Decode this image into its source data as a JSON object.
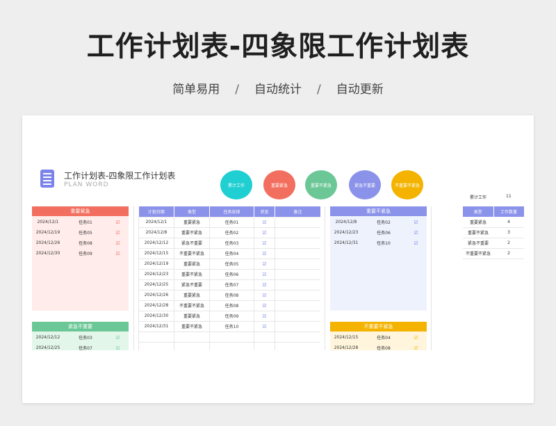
{
  "header": {
    "title": "工作计划表-四象限工作计划表",
    "tags": [
      "简单易用",
      "自动统计",
      "自动更新"
    ],
    "separator": "/"
  },
  "sheet": {
    "title": "工作计划表-四象限工作计划表",
    "subtitle": "PLAN WORD",
    "circles": [
      {
        "label": "累计工作",
        "color": "#1fcfd1"
      },
      {
        "label": "重要紧急",
        "color": "#f26f5f"
      },
      {
        "label": "重要不紧急",
        "color": "#6cc796"
      },
      {
        "label": "紧急不重要",
        "color": "#8a92ea"
      },
      {
        "label": "不重要不紧急",
        "color": "#f3b300"
      }
    ],
    "total_label": "累计工作",
    "total_value": "11"
  },
  "q_important_urgent": {
    "header": "重要紧急",
    "color": "#f26f5f",
    "bg": "#ffeceb",
    "rows": [
      [
        "2024/12/1",
        "任务01"
      ],
      [
        "2024/12/19",
        "任务05"
      ],
      [
        "2024/12/26",
        "任务08"
      ],
      [
        "2024/12/30",
        "任务09"
      ]
    ]
  },
  "q_urgent_not_important": {
    "header": "紧急不重要",
    "color": "#6cc796",
    "bg": "#e3f6ea",
    "rows": [
      [
        "2024/12/12",
        "任务03"
      ],
      [
        "2024/12/25",
        "任务07"
      ]
    ]
  },
  "main_table": {
    "columns": [
      "计划日期",
      "类型",
      "任务安排",
      "状态",
      "备注"
    ],
    "rows": [
      [
        "2024/12/1",
        "重要紧急",
        "任务01"
      ],
      [
        "2024/12/8",
        "重要不紧急",
        "任务02"
      ],
      [
        "2024/12/12",
        "紧急不重要",
        "任务03"
      ],
      [
        "2024/12/15",
        "不重要不紧急",
        "任务04"
      ],
      [
        "2024/12/19",
        "重要紧急",
        "任务05"
      ],
      [
        "2024/12/23",
        "重要不紧急",
        "任务06"
      ],
      [
        "2024/12/25",
        "紧急不重要",
        "任务07"
      ],
      [
        "2024/12/26",
        "重要紧急",
        "任务08"
      ],
      [
        "2024/12/28",
        "不重要不紧急",
        "任务08"
      ],
      [
        "2024/12/30",
        "重要紧急",
        "任务09"
      ],
      [
        "2024/12/31",
        "重要不紧急",
        "任务10"
      ]
    ]
  },
  "q_important_not_urgent": {
    "header": "重要不紧急",
    "color": "#8a92ea",
    "bg": "#eef2fd",
    "rows": [
      [
        "2024/12/8",
        "任务02"
      ],
      [
        "2024/12/23",
        "任务06"
      ],
      [
        "2024/12/31",
        "任务10"
      ]
    ]
  },
  "q_not_important_not_urgent": {
    "header": "不重要不紧急",
    "color": "#f3b300",
    "bg": "#fff5dc",
    "rows": [
      [
        "2024/12/15",
        "任务04"
      ],
      [
        "2024/12/28",
        "任务08"
      ]
    ]
  },
  "stats": {
    "columns": [
      "类型",
      "工作数量"
    ],
    "rows": [
      [
        "重要紧急",
        "4"
      ],
      [
        "重要不紧急",
        "3"
      ],
      [
        "紧急不重要",
        "2"
      ],
      [
        "不重要不紧急",
        "2"
      ]
    ]
  },
  "check_mark": "☑"
}
